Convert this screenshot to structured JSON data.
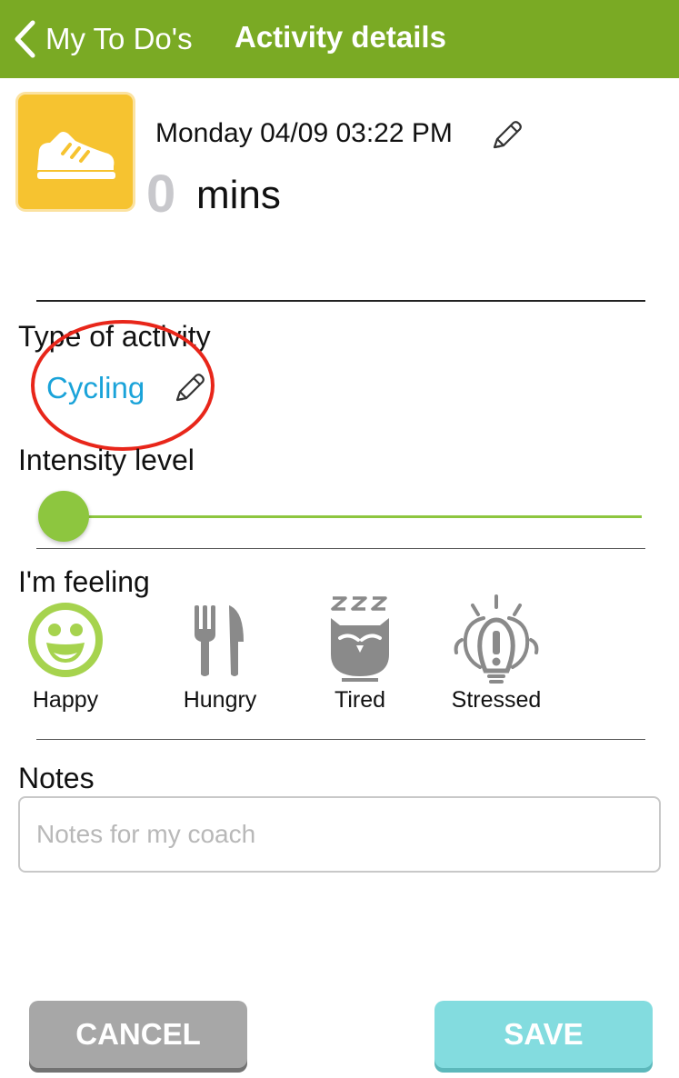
{
  "header": {
    "back_label": "My To Do's",
    "title": "Activity details"
  },
  "activity": {
    "icon": "sneaker-icon",
    "datetime": "Monday 04/09 03:22 PM",
    "duration_value": "0",
    "duration_unit": "mins"
  },
  "type_section": {
    "label": "Type of activity",
    "value": "Cycling"
  },
  "intensity": {
    "label": "Intensity level",
    "level": 0
  },
  "feeling": {
    "label": "I'm feeling",
    "options": [
      {
        "label": "Happy",
        "icon": "smiley-icon",
        "selected": true
      },
      {
        "label": "Hungry",
        "icon": "fork-knife-icon",
        "selected": false
      },
      {
        "label": "Tired",
        "icon": "sleepy-owl-icon",
        "selected": false
      },
      {
        "label": "Stressed",
        "icon": "exclamation-bulb-icon",
        "selected": false
      }
    ]
  },
  "notes": {
    "label": "Notes",
    "placeholder": "Notes for my coach",
    "value": ""
  },
  "buttons": {
    "cancel": "CANCEL",
    "save": "SAVE"
  },
  "colors": {
    "header_bg": "#7aaa24",
    "accent_green": "#8dc63f",
    "link_blue": "#1aa3d9",
    "activity_icon_bg": "#f6c330",
    "annotation_red": "#e8261a",
    "cancel_bg": "#a7a7a7",
    "save_bg": "#83dcdf"
  }
}
